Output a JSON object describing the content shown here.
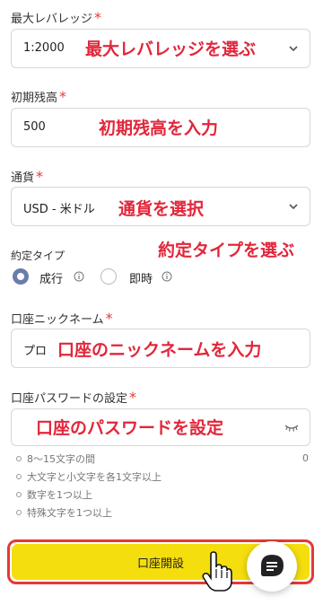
{
  "leverage": {
    "label": "最大レバレッジ",
    "required": "*",
    "value": "1:2000",
    "annotation": "最大レバレッジを選ぶ"
  },
  "balance": {
    "label": "初期残高",
    "required": "*",
    "value": "500",
    "annotation": "初期残高を入力"
  },
  "currency": {
    "label": "通貨",
    "required": "*",
    "value": "USD - 米ドル",
    "annotation": "通貨を選択"
  },
  "execution": {
    "label": "約定タイプ",
    "annotation": "約定タイプを選ぶ",
    "options": [
      {
        "label": "成行",
        "selected": true
      },
      {
        "label": "即時",
        "selected": false
      }
    ]
  },
  "nickname": {
    "label": "口座ニックネーム",
    "required": "*",
    "value": "プロ",
    "annotation": "口座のニックネームを入力"
  },
  "password": {
    "label": "口座パスワードの設定",
    "required": "*",
    "value": "",
    "annotation": "口座のパスワードを設定",
    "counter": "0",
    "rules": [
      "8～15文字の間",
      "大文字と小文字を各1文字以上",
      "数字を1つ以上",
      "特殊文字を1つ以上"
    ]
  },
  "submit": {
    "label": "口座開設"
  },
  "colors": {
    "accent": "#f5de0e",
    "annotation": "#e2263a",
    "highlight": "#e53935"
  }
}
